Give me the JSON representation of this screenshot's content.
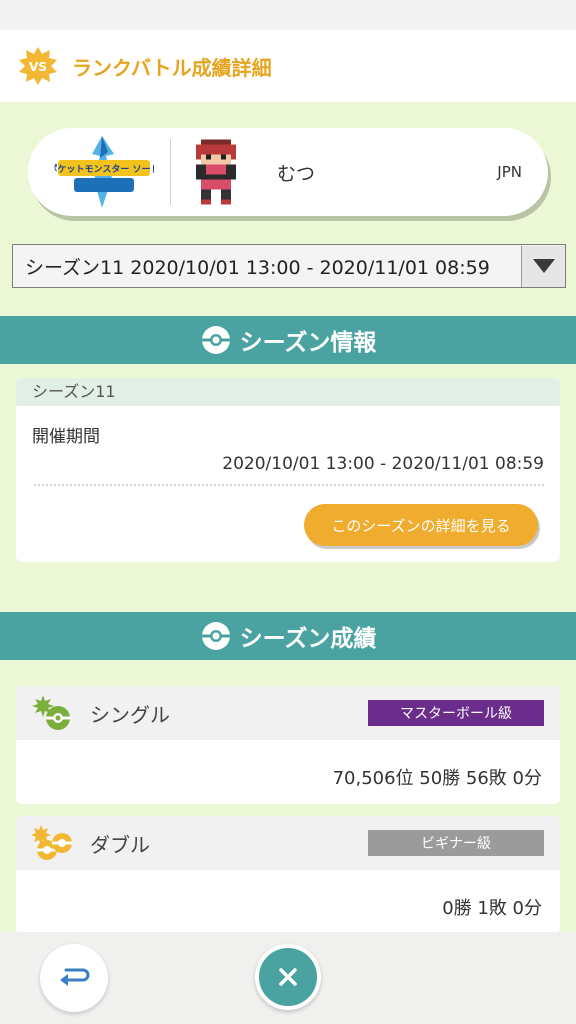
{
  "header": {
    "title": "ランクバトル成績詳細",
    "badge_text": "VS"
  },
  "profile": {
    "game_logo_text": "ポケットモンスター ソード",
    "trainer_name": "むつ",
    "region": "JPN"
  },
  "season_select": {
    "selected": "シーズン11 2020/10/01 13:00 - 2020/11/01 08:59"
  },
  "season_info": {
    "section_title": "シーズン情報",
    "season_name": "シーズン11",
    "period_label": "開催期間",
    "period_value": "2020/10/01 13:00 - 2020/11/01 08:59",
    "detail_button": "このシーズンの詳細を見る"
  },
  "season_results": {
    "section_title": "シーズン成績",
    "single": {
      "label": "シングル",
      "rank": "マスターボール級",
      "rank_color": "#6b2d8c",
      "record": "70,506位 50勝 56敗 0分"
    },
    "double": {
      "label": "ダブル",
      "rank": "ビギナー級",
      "rank_color": "#9b9b9b",
      "record": "0勝 1敗 0分"
    }
  },
  "nav": {
    "back_icon": "return-arrow-icon",
    "close_icon": "close-icon"
  },
  "colors": {
    "accent_orange": "#f0ac2e",
    "teal": "#4aa3a1",
    "mint": "#ecf7d6"
  }
}
